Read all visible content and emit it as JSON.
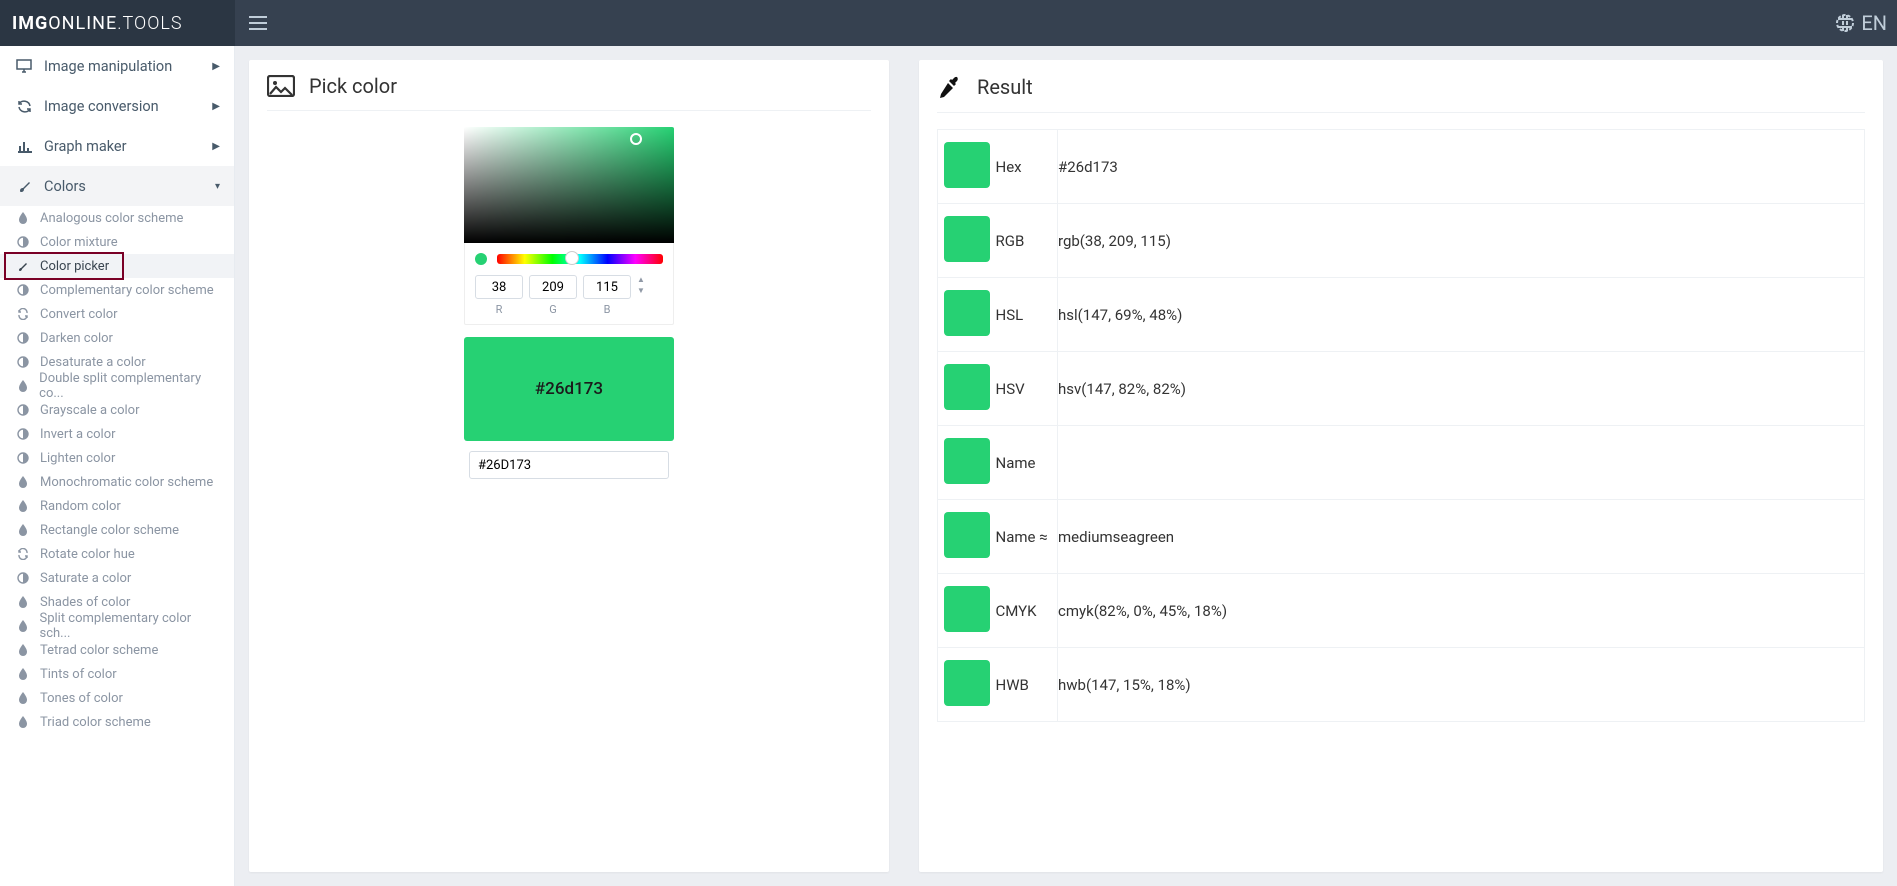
{
  "brand": {
    "strong": "IMG",
    "mid": "ONLINE",
    "thin": ".TOOLS"
  },
  "lang": "EN",
  "nav": [
    {
      "label": "Image manipulation",
      "caret": "▶"
    },
    {
      "label": "Image conversion",
      "caret": "▶"
    },
    {
      "label": "Graph maker",
      "caret": "▶"
    },
    {
      "label": "Colors",
      "caret": "▾"
    }
  ],
  "submenu": [
    "Analogous color scheme",
    "Color mixture",
    "Color picker",
    "Complementary color scheme",
    "Convert color",
    "Darken color",
    "Desaturate a color",
    "Double split complementary co...",
    "Grayscale a color",
    "Invert a color",
    "Lighten color",
    "Monochromatic color scheme",
    "Random color",
    "Rectangle color scheme",
    "Rotate color hue",
    "Saturate a color",
    "Shades of color",
    "Split complementary color sch...",
    "Tetrad color scheme",
    "Tints of color",
    "Tones of color",
    "Triad color scheme"
  ],
  "picker": {
    "heading": "Pick color",
    "r": "38",
    "g": "209",
    "b": "115",
    "r_label": "R",
    "g_label": "G",
    "b_label": "B",
    "swatch_label": "#26d173",
    "hex_input": "#26D173",
    "color": "#26d173"
  },
  "result": {
    "heading": "Result",
    "rows": [
      {
        "label": "Hex",
        "value": "#26d173"
      },
      {
        "label": "RGB",
        "value": "rgb(38, 209, 115)"
      },
      {
        "label": "HSL",
        "value": "hsl(147, 69%, 48%)"
      },
      {
        "label": "HSV",
        "value": "hsv(147, 82%, 82%)"
      },
      {
        "label": "Name",
        "value": ""
      },
      {
        "label": "Name ≈",
        "value": "mediumseagreen"
      },
      {
        "label": "CMYK",
        "value": "cmyk(82%, 0%, 45%, 18%)"
      },
      {
        "label": "HWB",
        "value": "hwb(147, 15%, 18%)"
      }
    ]
  }
}
